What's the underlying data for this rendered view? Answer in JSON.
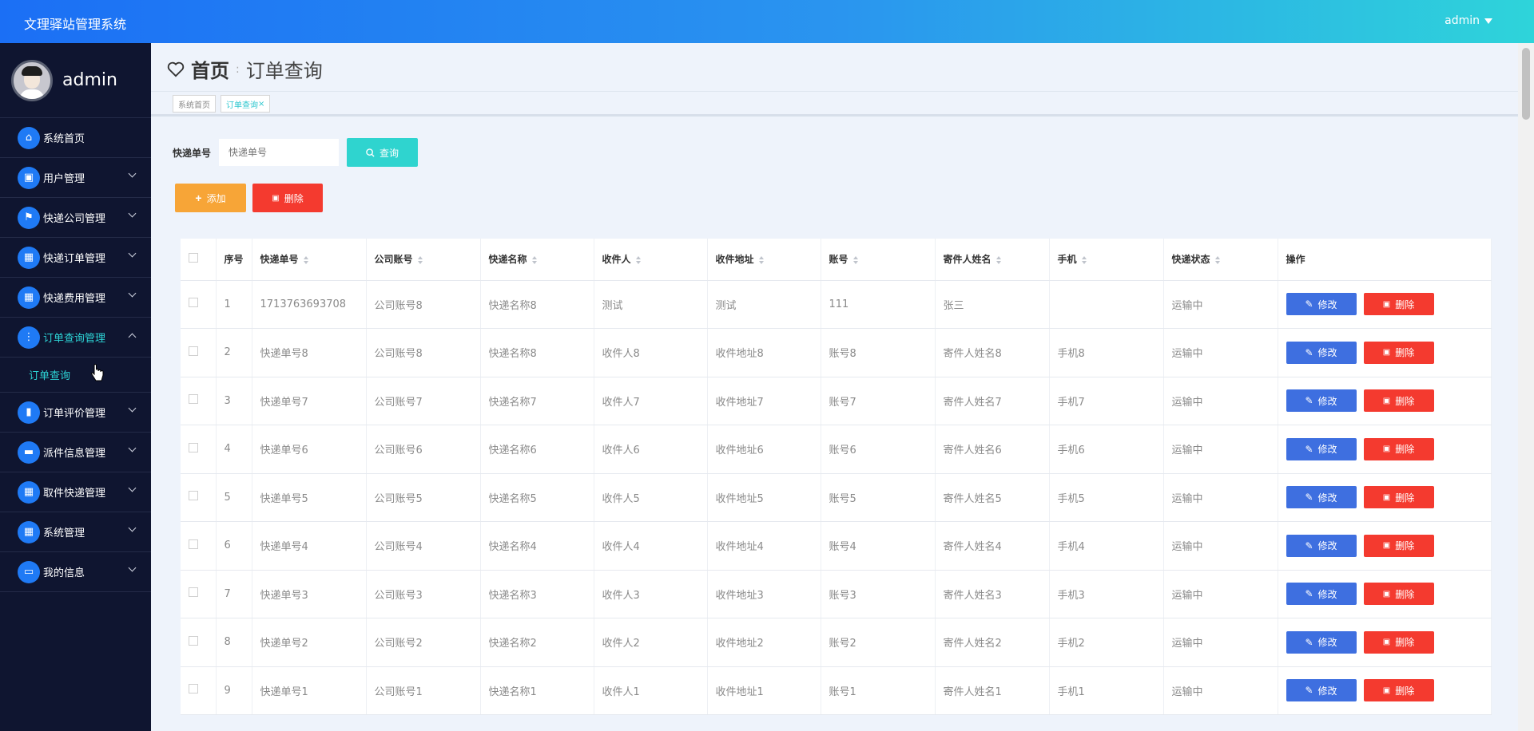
{
  "app": {
    "title": "文理驿站管理系统",
    "user": "admin"
  },
  "sidebar": {
    "profile_name": "admin",
    "items": [
      {
        "label": "系统首页",
        "icon": "home-icon",
        "glyph": "⌂",
        "chevron": false
      },
      {
        "label": "用户管理",
        "icon": "clipboard-icon",
        "glyph": "▣",
        "chevron": true
      },
      {
        "label": "快递公司管理",
        "icon": "flag-icon",
        "glyph": "⚑",
        "chevron": true
      },
      {
        "label": "快递订单管理",
        "icon": "grid-icon",
        "glyph": "▦",
        "chevron": true
      },
      {
        "label": "快递费用管理",
        "icon": "grid-icon",
        "glyph": "▦",
        "chevron": true
      },
      {
        "label": "订单查询管理",
        "icon": "apps-icon",
        "glyph": "⋮",
        "chevron": true,
        "expanded": true
      },
      {
        "label": "订单评价管理",
        "icon": "bar-chart-icon",
        "glyph": "▮",
        "chevron": true
      },
      {
        "label": "派件信息管理",
        "icon": "ticket-icon",
        "glyph": "▬",
        "chevron": true
      },
      {
        "label": "取件快递管理",
        "icon": "grid-icon",
        "glyph": "▦",
        "chevron": true
      },
      {
        "label": "系统管理",
        "icon": "grid-icon",
        "glyph": "▦",
        "chevron": true
      },
      {
        "label": "我的信息",
        "icon": "card-icon",
        "glyph": "▭",
        "chevron": true
      }
    ],
    "sub_item": "订单查询"
  },
  "breadcrumb": {
    "home": "首页",
    "current": "订单查询"
  },
  "tabs": [
    {
      "label": "系统首页"
    },
    {
      "label": "订单查询",
      "close": "×"
    }
  ],
  "search": {
    "label": "快递单号",
    "placeholder": "快递单号",
    "button": "查询"
  },
  "actions": {
    "add": "添加",
    "delete": "删除"
  },
  "table": {
    "headers": [
      "序号",
      "快递单号",
      "公司账号",
      "快递名称",
      "收件人",
      "收件地址",
      "账号",
      "寄件人姓名",
      "手机",
      "快递状态",
      "操作"
    ],
    "rows": [
      [
        "1",
        "1713763693708",
        "公司账号8",
        "快递名称8",
        "测试",
        "测试",
        "111",
        "张三",
        "",
        "运输中"
      ],
      [
        "2",
        "快递单号8",
        "公司账号8",
        "快递名称8",
        "收件人8",
        "收件地址8",
        "账号8",
        "寄件人姓名8",
        "手机8",
        "运输中"
      ],
      [
        "3",
        "快递单号7",
        "公司账号7",
        "快递名称7",
        "收件人7",
        "收件地址7",
        "账号7",
        "寄件人姓名7",
        "手机7",
        "运输中"
      ],
      [
        "4",
        "快递单号6",
        "公司账号6",
        "快递名称6",
        "收件人6",
        "收件地址6",
        "账号6",
        "寄件人姓名6",
        "手机6",
        "运输中"
      ],
      [
        "5",
        "快递单号5",
        "公司账号5",
        "快递名称5",
        "收件人5",
        "收件地址5",
        "账号5",
        "寄件人姓名5",
        "手机5",
        "运输中"
      ],
      [
        "6",
        "快递单号4",
        "公司账号4",
        "快递名称4",
        "收件人4",
        "收件地址4",
        "账号4",
        "寄件人姓名4",
        "手机4",
        "运输中"
      ],
      [
        "7",
        "快递单号3",
        "公司账号3",
        "快递名称3",
        "收件人3",
        "收件地址3",
        "账号3",
        "寄件人姓名3",
        "手机3",
        "运输中"
      ],
      [
        "8",
        "快递单号2",
        "公司账号2",
        "快递名称2",
        "收件人2",
        "收件地址2",
        "账号2",
        "寄件人姓名2",
        "手机2",
        "运输中"
      ],
      [
        "9",
        "快递单号1",
        "公司账号1",
        "快递名称1",
        "收件人1",
        "收件地址1",
        "账号1",
        "寄件人姓名1",
        "手机1",
        "运输中"
      ]
    ],
    "edit_label": "修改",
    "delete_label": "删除"
  },
  "colors": {
    "accent": "#2dd4d6",
    "primary": "#1f7af5",
    "danger": "#f43a2f",
    "warning": "#f7a537",
    "edit": "#3e6fe0",
    "sidebar": "#0f1530"
  }
}
